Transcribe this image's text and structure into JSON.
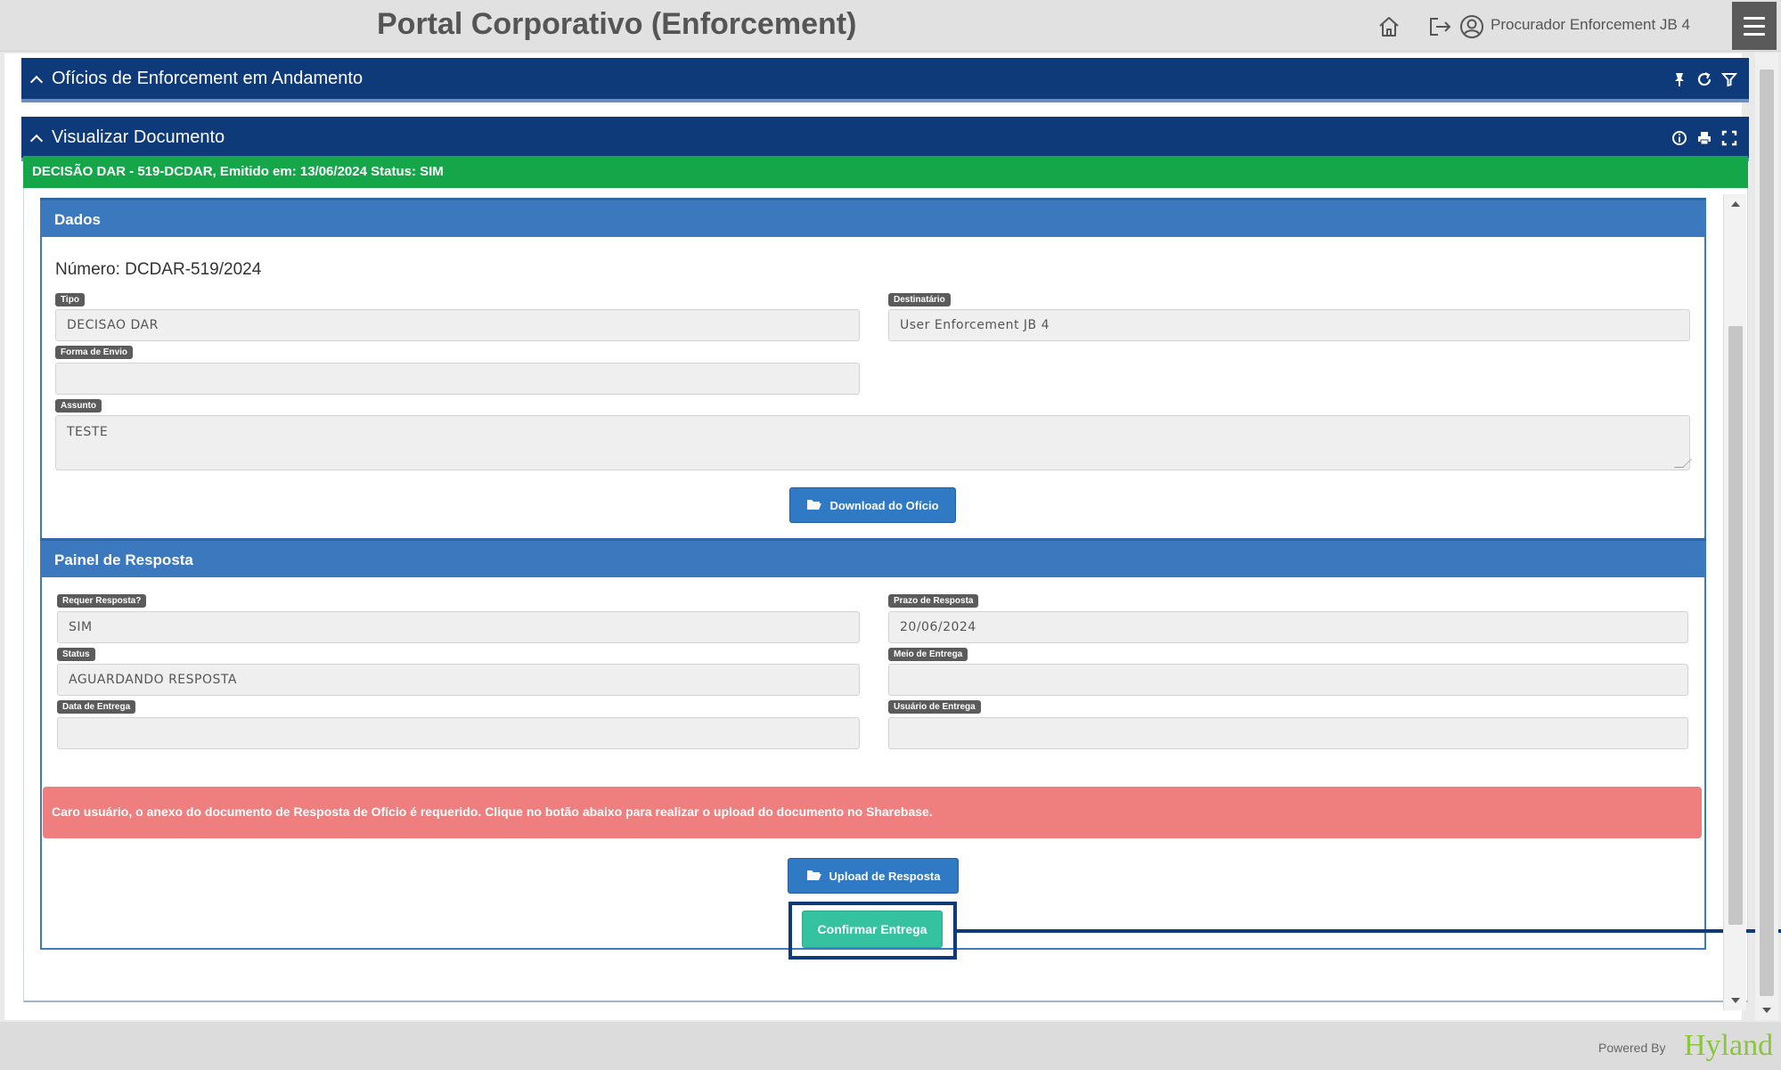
{
  "app": {
    "title": "Portal Corporativo (Enforcement)",
    "user_name": "Procurador Enforcement JB 4"
  },
  "panels": {
    "oficios": {
      "title": "Ofícios de Enforcement em Andamento"
    },
    "visualizar": {
      "title": "Visualizar Documento"
    }
  },
  "status_strip": "DECISÃO DAR - 519-DCDAR, Emitido em: 13/06/2024 Status: SIM",
  "dados": {
    "header": "Dados",
    "numero": "Número: DCDAR-519/2024",
    "fields": {
      "tipo": {
        "label": "Tipo",
        "value": "DECISAO DAR"
      },
      "destinatario": {
        "label": "Destinatário",
        "value": "User Enforcement JB 4"
      },
      "forma_envio": {
        "label": "Forma de Envio",
        "value": ""
      },
      "assunto": {
        "label": "Assunto",
        "value": "TESTE"
      }
    },
    "download_button": "Download do Ofício"
  },
  "resposta": {
    "header": "Painel de Resposta",
    "fields": {
      "requer_resposta": {
        "label": "Requer Resposta?",
        "value": "SIM"
      },
      "prazo_resposta": {
        "label": "Prazo de Resposta",
        "value": "20/06/2024"
      },
      "status": {
        "label": "Status",
        "value": "AGUARDANDO RESPOSTA"
      },
      "meio_entrega": {
        "label": "Meio de Entrega",
        "value": ""
      },
      "data_entrega": {
        "label": "Data de Entrega",
        "value": ""
      },
      "usuario_entrega": {
        "label": "Usuário de Entrega",
        "value": ""
      }
    },
    "alert": "Caro usuário, o anexo do documento de Resposta de Ofício é requerido. Clique no botão abaixo para realizar o upload do documento no Sharebase.",
    "upload_button": "Upload de Resposta",
    "confirm_button": "Confirmar Entrega"
  },
  "footer": {
    "powered_by": "Powered By",
    "brand": "Hyland"
  },
  "colors": {
    "navy": "#0f3a7a",
    "section_blue": "#3b78bd",
    "status_green": "#15a64a",
    "alert_red": "#ee7f7e",
    "confirm_teal": "#35c2a0",
    "brand_green": "#8bc43f"
  }
}
